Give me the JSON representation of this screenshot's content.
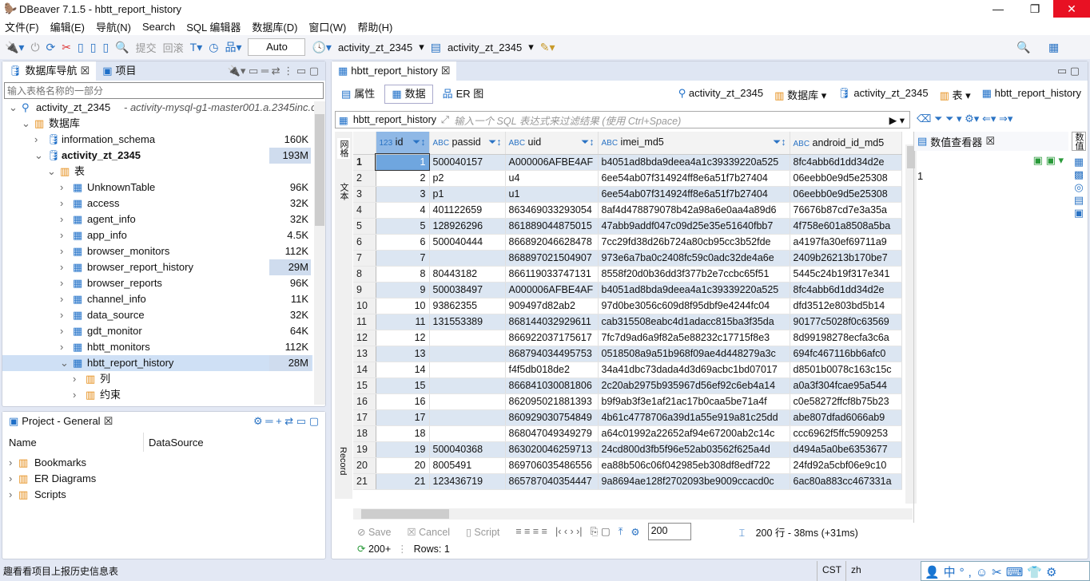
{
  "window": {
    "title": "DBeaver 7.1.5 - hbtt_report_history"
  },
  "menu": [
    "文件(F)",
    "编辑(E)",
    "导航(N)",
    "Search",
    "SQL 编辑器",
    "数据库(D)",
    "窗口(W)",
    "帮助(H)"
  ],
  "toolbar": {
    "commit": "提交",
    "rollback": "回滚",
    "tx_mode": "Auto",
    "conn1": "activity_zt_2345",
    "conn2": "activity_zt_2345"
  },
  "navigator": {
    "tab1": "数据库导航",
    "tab2": "项目",
    "filter_placeholder": "输入表格名称的一部分",
    "tree": [
      {
        "level": 0,
        "label": "activity_zt_2345",
        "extra": "- activity-mysql-g1-master001.a.2345inc.com",
        "icon": "connection-icon",
        "exp": "v"
      },
      {
        "level": 1,
        "label": "数据库",
        "icon": "folder-icon",
        "exp": "v"
      },
      {
        "level": 2,
        "label": "information_schema",
        "size": "160K",
        "icon": "database-icon",
        "exp": ">"
      },
      {
        "level": 2,
        "label": "activity_zt_2345",
        "size": "193M",
        "icon": "database-icon",
        "exp": "v",
        "bold": true,
        "hl": true
      },
      {
        "level": 3,
        "label": "表",
        "icon": "folder-icon",
        "exp": "v"
      },
      {
        "level": 4,
        "label": "UnknownTable",
        "size": "96K",
        "icon": "table-icon",
        "exp": ">"
      },
      {
        "level": 4,
        "label": "access",
        "size": "32K",
        "icon": "table-icon",
        "exp": ">"
      },
      {
        "level": 4,
        "label": "agent_info",
        "size": "32K",
        "icon": "table-icon",
        "exp": ">"
      },
      {
        "level": 4,
        "label": "app_info",
        "size": "4.5K",
        "icon": "table-icon",
        "exp": ">"
      },
      {
        "level": 4,
        "label": "browser_monitors",
        "size": "112K",
        "icon": "table-icon",
        "exp": ">"
      },
      {
        "level": 4,
        "label": "browser_report_history",
        "size": "29M",
        "icon": "table-icon",
        "exp": ">",
        "hl": true
      },
      {
        "level": 4,
        "label": "browser_reports",
        "size": "96K",
        "icon": "table-icon",
        "exp": ">"
      },
      {
        "level": 4,
        "label": "channel_info",
        "size": "11K",
        "icon": "table-icon",
        "exp": ">"
      },
      {
        "level": 4,
        "label": "data_source",
        "size": "32K",
        "icon": "table-icon",
        "exp": ">"
      },
      {
        "level": 4,
        "label": "gdt_monitor",
        "size": "64K",
        "icon": "table-icon",
        "exp": ">"
      },
      {
        "level": 4,
        "label": "hbtt_monitors",
        "size": "112K",
        "icon": "table-icon",
        "exp": ">"
      },
      {
        "level": 4,
        "label": "hbtt_report_history",
        "size": "28M",
        "icon": "table-icon",
        "exp": "v",
        "sel": true,
        "hl": true
      },
      {
        "level": 5,
        "label": "列",
        "icon": "folder-icon",
        "exp": ">"
      },
      {
        "level": 5,
        "label": "约束",
        "icon": "folder-icon",
        "exp": ">"
      }
    ]
  },
  "project": {
    "tab": "Project - General",
    "col1": "Name",
    "col2": "DataSource",
    "items": [
      "Bookmarks",
      "ER Diagrams",
      "Scripts"
    ]
  },
  "editor": {
    "tab": "hbtt_report_history",
    "subtabs": [
      "属性",
      "数据",
      "ER 图"
    ],
    "breadcrumb": [
      "activity_zt_2345",
      "数据库",
      "activity_zt_2345",
      "表",
      "hbtt_report_history"
    ],
    "filter_table": "hbtt_report_history",
    "filter_placeholder": "输入一个 SQL 表达式来过滤结果 (使用 Ctrl+Space)",
    "side_tabs": {
      "grid": "网格",
      "text": "文本",
      "record": "Record"
    },
    "columns": [
      "id",
      "passid",
      "uid",
      "imei_md5",
      "android_id_md5"
    ],
    "rows": [
      [
        "1",
        "500040157",
        "A000006AFBE4AF",
        "b4051ad8bda9deea4a1c39339220a525",
        "8fc4abb6d1dd34d2e"
      ],
      [
        "2",
        "p2",
        "u4",
        "6ee54ab07f314924ff8e6a51f7b27404",
        "06eebb0e9d5e25308"
      ],
      [
        "3",
        "p1",
        "u1",
        "6ee54ab07f314924ff8e6a51f7b27404",
        "06eebb0e9d5e25308"
      ],
      [
        "4",
        "401122659",
        "863469033293054",
        "8af4d478879078b42a98a6e0aa4a89d6",
        "76676b87cd7e3a35a"
      ],
      [
        "5",
        "128926296",
        "861889044875015",
        "47abb9addf047c09d25e35e51640fbb7",
        "4f758e601a8508a5ba"
      ],
      [
        "6",
        "500040444",
        "866892046628478",
        "7cc29fd38d26b724a80cb95cc3b52fde",
        "a4197fa30ef69711a9"
      ],
      [
        "7",
        "",
        "868897021504907",
        "973e6a7ba0c2408fc59c0adc32de4a6e",
        "2409b26213b170be7"
      ],
      [
        "8",
        "80443182",
        "866119033747131",
        "8558f20d0b36dd3f377b2e7ccbc65f51",
        "5445c24b19f317e341"
      ],
      [
        "9",
        "500038497",
        "A000006AFBE4AF",
        "b4051ad8bda9deea4a1c39339220a525",
        "8fc4abb6d1dd34d2e"
      ],
      [
        "10",
        "93862355",
        "909497d82ab2",
        "97d0be3056c609d8f95dbf9e4244fc04",
        "dfd3512e803bd5b14"
      ],
      [
        "11",
        "131553389",
        "868144032929611",
        "cab315508eabc4d1adacc815ba3f35da",
        "90177c5028f0c63569"
      ],
      [
        "12",
        "",
        "866922037175617",
        "7fc7d9ad6a9f82a5e88232c17715f8e3",
        "8d99198278ecfa3c6a"
      ],
      [
        "13",
        "",
        "868794034495753",
        "0518508a9a51b968f09ae4d448279a3c",
        "694fc467116bb6afc0"
      ],
      [
        "14",
        "",
        "f4f5db018de2",
        "34a41dbc73dada4d3d69acbc1bd07017",
        "d8501b0078c163c15c"
      ],
      [
        "15",
        "",
        "866841030081806",
        "2c20ab2975b935967d56ef92c6eb4a14",
        "a0a3f304fcae95a544"
      ],
      [
        "16",
        "",
        "862095021881393",
        "b9f9ab3f3e1af21ac17b0caa5be71a4f",
        "c0e58272ffcf8b75b23"
      ],
      [
        "17",
        "",
        "860929030754849",
        "4b61c4778706a39d1a55e919a81c25dd",
        "abe807dfad6066ab9"
      ],
      [
        "18",
        "",
        "868047049349279",
        "a64c01992a22652af94e67200ab2c14c",
        "ccc6962f5ffc5909253"
      ],
      [
        "19",
        "500040368",
        "863020046259713",
        "24cd800d3fb5f96e52ab03562f625a4d",
        "d494a5a0be6353677"
      ],
      [
        "20",
        "8005491",
        "869706035486556",
        "ea88b506c06f042985eb308df8edf722",
        "24fd92a5cbf06e9c10"
      ],
      [
        "21",
        "123436719",
        "865787040354447",
        "9a8694ae128f2702093be9009ccacd0c",
        "6ac80a883cc467331a"
      ]
    ],
    "value_viewer": {
      "title": "数值查看器",
      "value": "1"
    },
    "bottom": {
      "save": "Save",
      "cancel": "Cancel",
      "script": "Script",
      "fetch_size": "200",
      "result_info": "200 行 - 38ms (+31ms)",
      "fetch_more": "200+",
      "rows": "Rows: 1"
    }
  },
  "status": {
    "message": "趣看看项目上报历史信息表",
    "tz": "CST",
    "locale": "zh"
  }
}
